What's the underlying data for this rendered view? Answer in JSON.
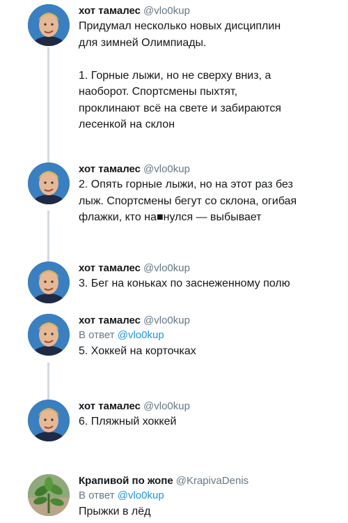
{
  "tweets": [
    {
      "name": "хот тамалес",
      "handle": "@vlo0kup",
      "text": "Придумал несколько новых дисциплин\nдля зимней Олимпиады.\n\n1. Горные лыжи, но не сверху вниз, а\nнаоборот. Спортсмены пыхтят,\nпроклинают всё на свете и забираются\nлесенкой на склон"
    },
    {
      "name": "хот тамалес",
      "handle": "@vlo0kup",
      "text": "2. Опять горные лыжи, но на этот раз без\nлыж. Спортсмены бегут со склона, огибая\nфлажки, кто на■нулся — выбывает"
    },
    {
      "name": "хот тамалес",
      "handle": "@vlo0kup",
      "text": "3. Бег на коньках по заснеженному полю"
    },
    {
      "name": "хот тамалес",
      "handle": "@vlo0kup",
      "reply_prefix": "В ответ",
      "reply_mention": "@vlo0kup",
      "text": "5. Хоккей на корточках"
    },
    {
      "name": "хот тамалес",
      "handle": "@vlo0kup",
      "text": "6. Пляжный хоккей"
    },
    {
      "name": "Крапивой по жопе",
      "handle": "@KrapivaDenis",
      "reply_prefix": "В ответ",
      "reply_mention": "@vlo0kup",
      "text": "Прыжки в лёд"
    }
  ],
  "colors": {
    "name": "#14171a",
    "handle": "#657786",
    "mention": "#1b95e0",
    "thread_line": "#d4d9de"
  }
}
